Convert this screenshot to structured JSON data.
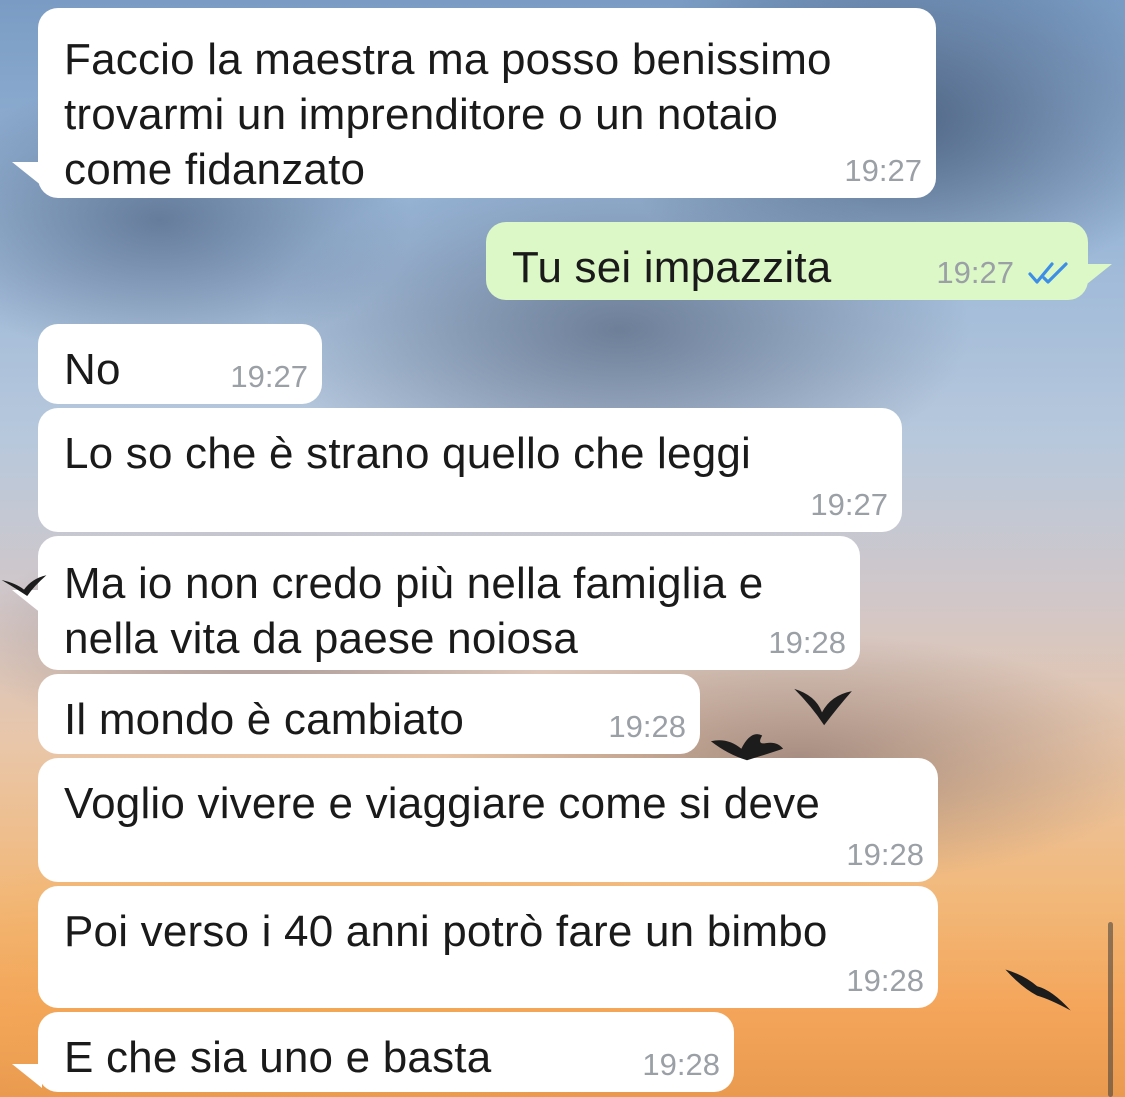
{
  "messages": [
    {
      "direction": "incoming",
      "text": "Faccio la maestra ma posso benissimo\ntrovarmi un imprenditore o un notaio\ncome fidanzato",
      "time": "19:27"
    },
    {
      "direction": "outgoing",
      "text": "Tu sei impazzita",
      "time": "19:27",
      "status": "read"
    },
    {
      "direction": "incoming",
      "text": "No",
      "time": "19:27"
    },
    {
      "direction": "incoming",
      "text": "Lo so che è strano quello che leggi",
      "time": "19:27"
    },
    {
      "direction": "incoming",
      "text": "Ma io non credo più nella famiglia e\nnella vita da paese noiosa",
      "time": "19:28"
    },
    {
      "direction": "incoming",
      "text": "Il mondo è cambiato",
      "time": "19:28"
    },
    {
      "direction": "incoming",
      "text": "Voglio vivere e viaggiare come si deve",
      "time": "19:28"
    },
    {
      "direction": "incoming",
      "text": "Poi verso i 40 anni potrò fare un bimbo",
      "time": "19:28"
    },
    {
      "direction": "incoming",
      "text": "E che sia uno e basta",
      "time": "19:28"
    }
  ],
  "colors": {
    "incoming_bubble": "#ffffff",
    "outgoing_bubble": "#dcf8c6",
    "timestamp": "#9aa0a6",
    "read_ticks": "#3d8ee6"
  },
  "icons": {
    "read_receipt": "double-check-icon"
  }
}
